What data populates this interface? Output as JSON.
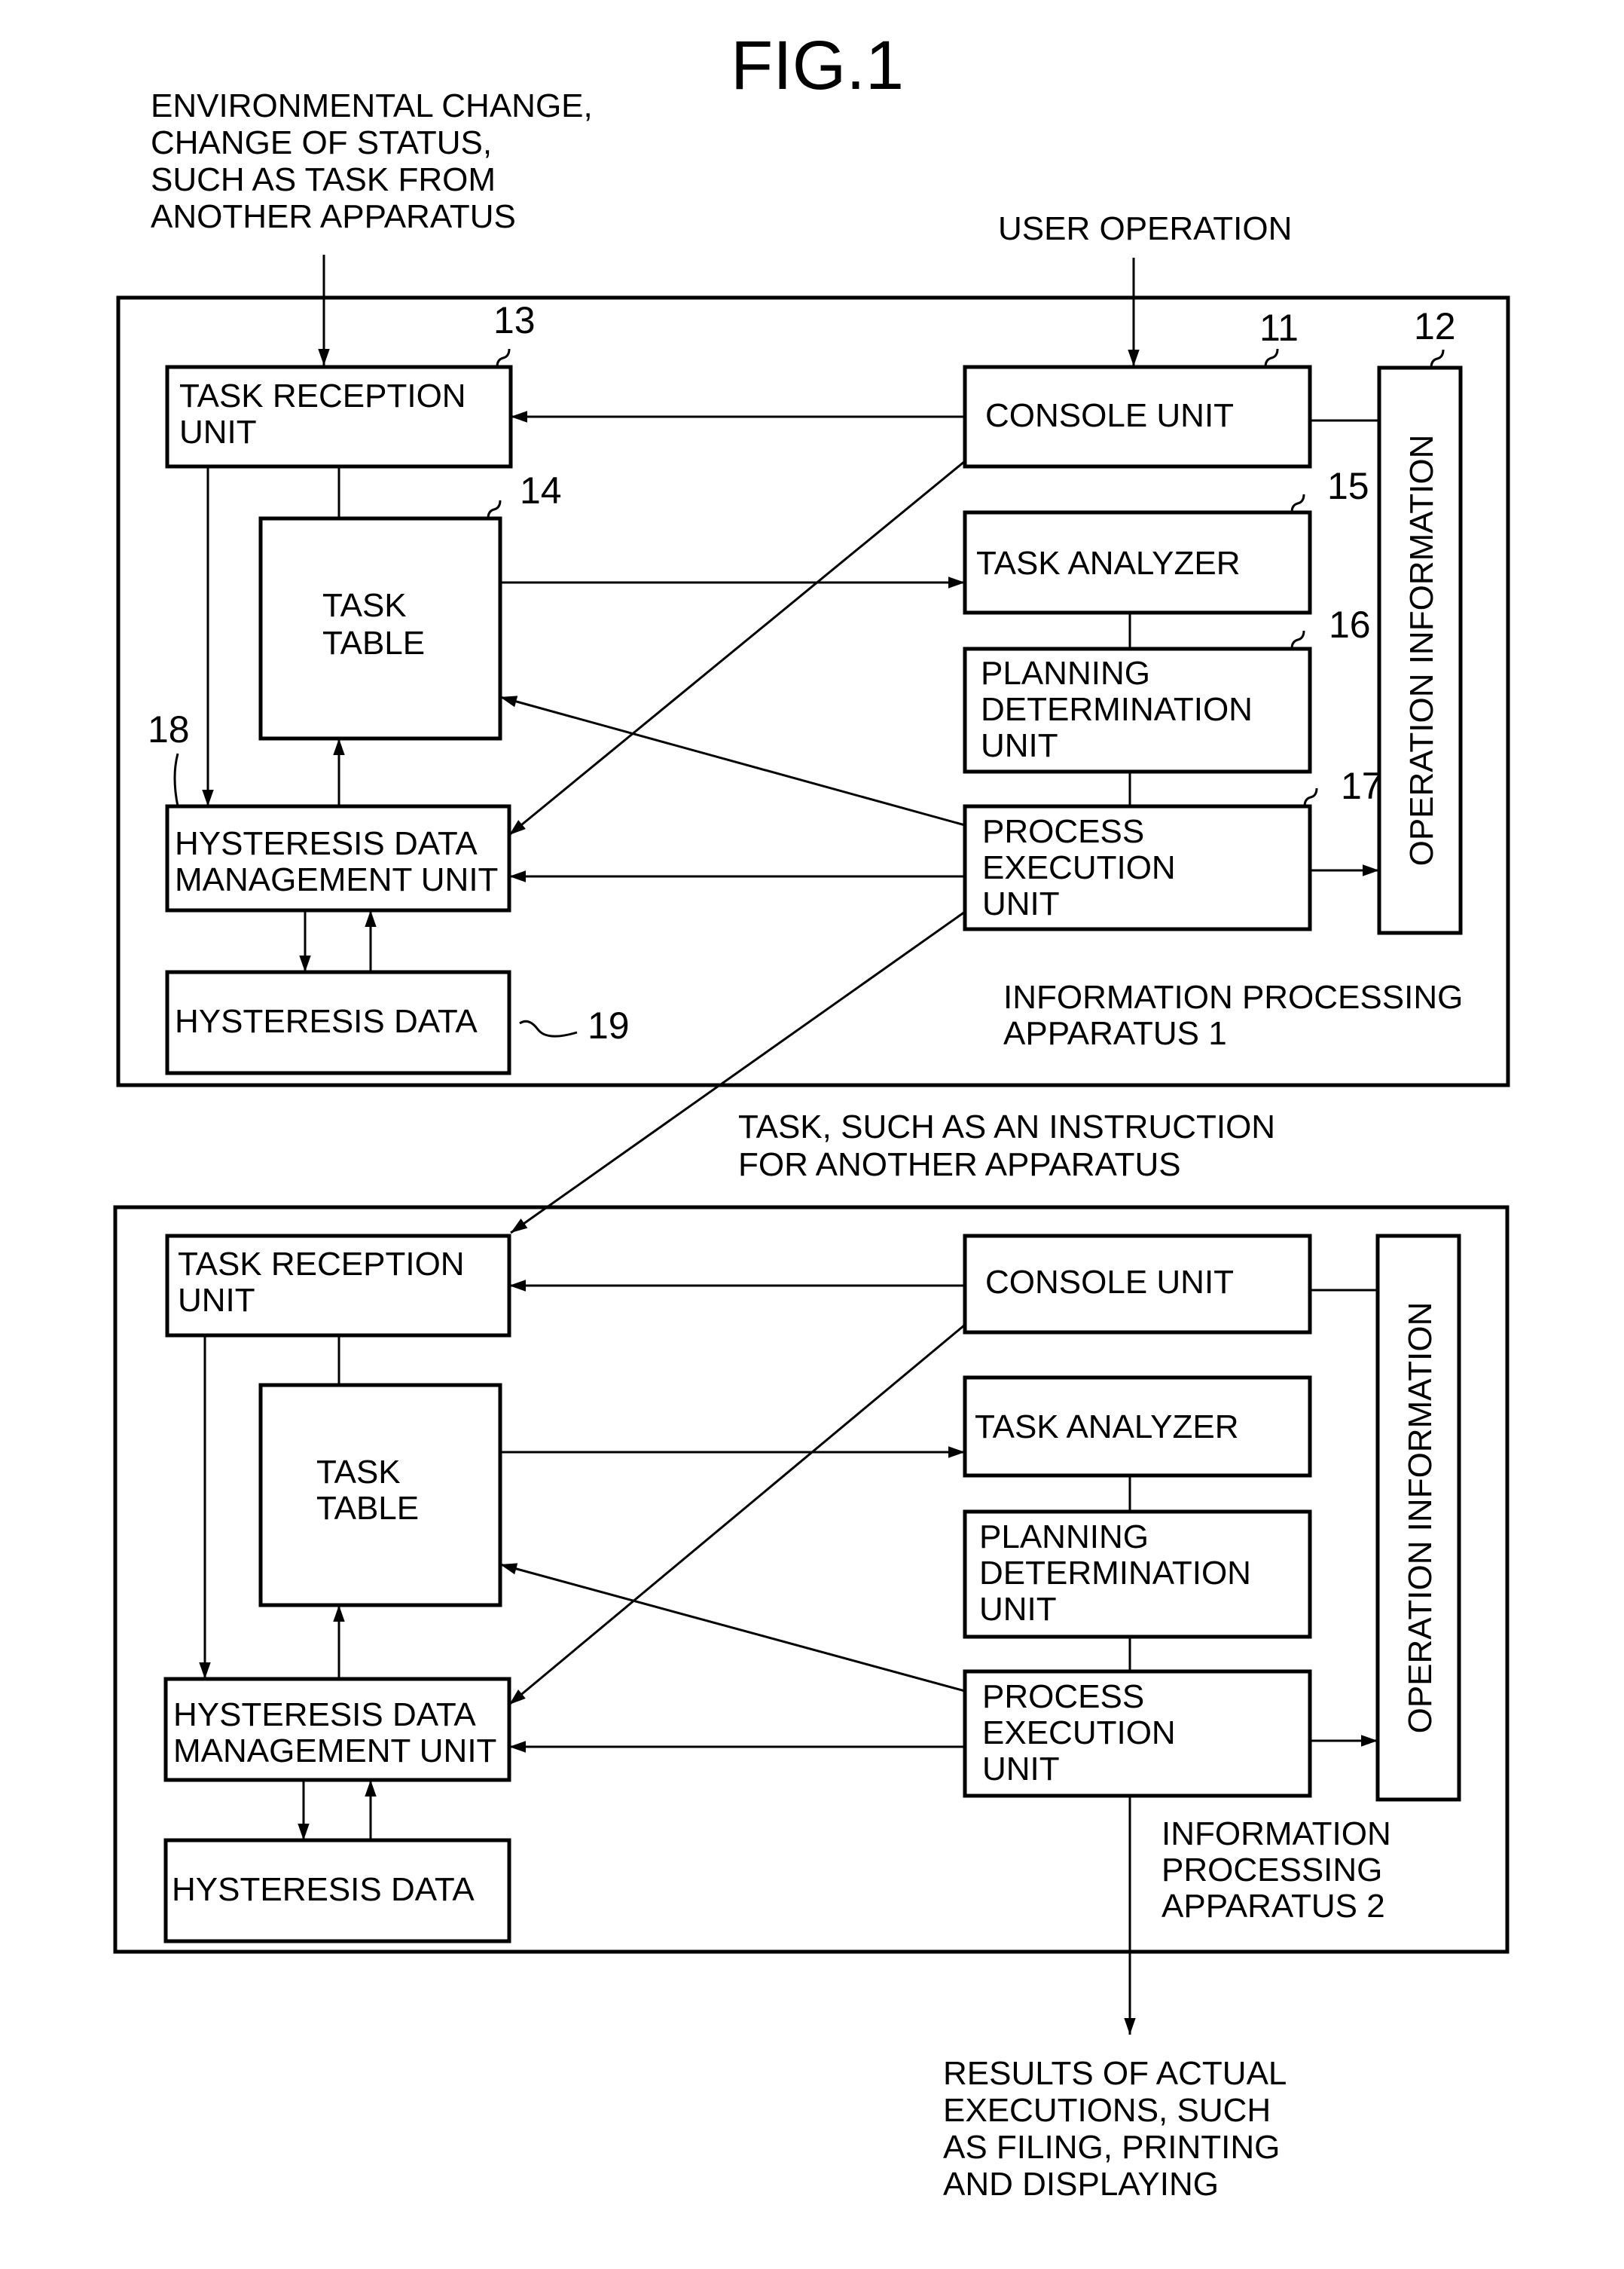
{
  "figure": {
    "title": "FIG.1",
    "inputs": {
      "environmental": [
        "ENVIRONMENTAL CHANGE,",
        "CHANGE OF STATUS,",
        "SUCH AS TASK FROM",
        " ANOTHER APPARATUS"
      ],
      "user_operation": "USER OPERATION"
    },
    "between_label": [
      "TASK, SUCH AS AN INSTRUCTION",
      "FOR ANOTHER APPARATUS"
    ],
    "output_label": [
      "RESULTS OF ACTUAL",
      "EXECUTIONS, SUCH",
      "AS FILING, PRINTING",
      "AND DISPLAYING"
    ],
    "apparatus1": {
      "name": [
        "INFORMATION PROCESSING",
        " APPARATUS 1"
      ],
      "task_reception": [
        "TASK RECEPTION",
        "UNIT"
      ],
      "task_table": [
        "TASK",
        "TABLE"
      ],
      "hysteresis_mgmt": [
        "HYSTERESIS DATA",
        "MANAGEMENT UNIT"
      ],
      "hysteresis_data": "HYSTERESIS DATA",
      "console": "CONSOLE UNIT",
      "task_analyzer": "TASK ANALYZER",
      "planning": [
        "PLANNING",
        "DETERMINATION",
        "UNIT"
      ],
      "process_exec": [
        "PROCESS",
        "EXECUTION",
        "UNIT"
      ],
      "operation_info": "OPERATION INFORMATION",
      "refs": {
        "console": "11",
        "operation_info": "12",
        "task_reception": "13",
        "task_table": "14",
        "task_analyzer": "15",
        "planning": "16",
        "process_exec": "17",
        "hysteresis_mgmt": "18",
        "hysteresis_data": "19"
      }
    },
    "apparatus2": {
      "name": [
        "INFORMATION",
        "PROCESSING",
        " APPARATUS 2"
      ],
      "task_reception": [
        "TASK RECEPTION",
        "UNIT"
      ],
      "task_table": [
        "TASK",
        "TABLE"
      ],
      "hysteresis_mgmt": [
        "HYSTERESIS DATA",
        "MANAGEMENT UNIT"
      ],
      "hysteresis_data": "HYSTERESIS DATA",
      "console": "CONSOLE UNIT",
      "task_analyzer": "TASK ANALYZER",
      "planning": [
        "PLANNING",
        "DETERMINATION",
        "UNIT"
      ],
      "process_exec": [
        "PROCESS",
        "EXECUTION",
        "UNIT"
      ],
      "operation_info": "OPERATION INFORMATION"
    }
  }
}
